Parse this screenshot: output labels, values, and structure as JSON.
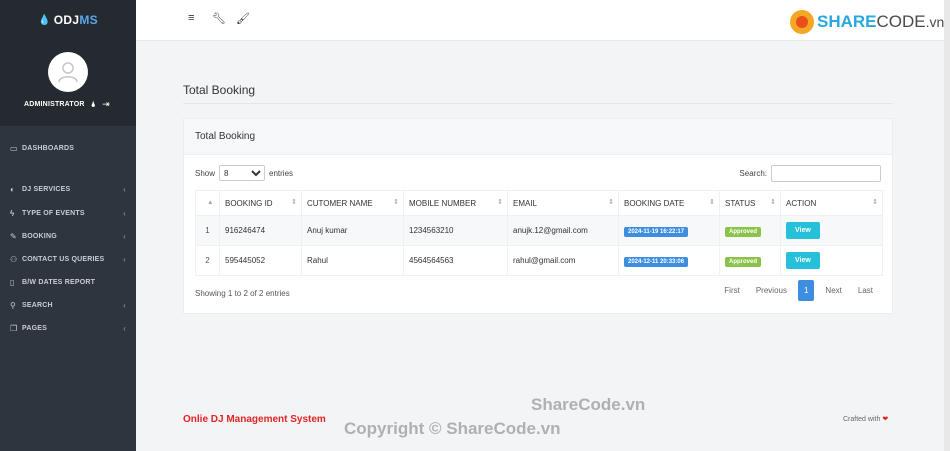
{
  "brand": {
    "name_a": "ODJ",
    "name_b": "MS"
  },
  "user": {
    "role": "ADMINISTRATOR"
  },
  "nav": [
    {
      "label": "DASHBOARDS",
      "icon": "dashboard-icon",
      "has_sub": false
    },
    {
      "label": "DJ SERVICES",
      "icon": "headphones-icon",
      "has_sub": true
    },
    {
      "label": "TYPE OF EVENTS",
      "icon": "bolt-icon",
      "has_sub": true
    },
    {
      "label": "BOOKING",
      "icon": "edit-icon",
      "has_sub": true
    },
    {
      "label": "CONTACT US QUERIES",
      "icon": "users-icon",
      "has_sub": true
    },
    {
      "label": "B/W DATES REPORT",
      "icon": "file-icon",
      "has_sub": false
    },
    {
      "label": "SEARCH",
      "icon": "search-icon",
      "has_sub": true
    },
    {
      "label": "PAGES",
      "icon": "copy-icon",
      "has_sub": true
    }
  ],
  "page": {
    "title": "Total Booking"
  },
  "card": {
    "title": "Total Booking",
    "show_label": "Show",
    "entries_label": "entries",
    "page_length": "8",
    "search_label": "Search:",
    "search_value": ""
  },
  "table": {
    "columns": [
      "",
      "BOOKING ID",
      "CUTOMER NAME",
      "MOBILE NUMBER",
      "EMAIL",
      "BOOKING DATE",
      "STATUS",
      "ACTION"
    ],
    "rows": [
      {
        "num": "1",
        "booking_id": "916246474",
        "name": "Anuj kumar",
        "mobile": "1234563210",
        "email": "anujk.12@gmail.com",
        "date": "2024-11-19 16:22:17",
        "status": "Approved",
        "action": "View"
      },
      {
        "num": "2",
        "booking_id": "595445052",
        "name": "Rahul",
        "mobile": "4564564563",
        "email": "rahul@gmail.com",
        "date": "2024-12-11 20:33:06",
        "status": "Approved",
        "action": "View"
      }
    ]
  },
  "info": "Showing 1 to 2 of 2 entries",
  "pager": {
    "first": "First",
    "previous": "Previous",
    "current": "1",
    "next": "Next",
    "last": "Last"
  },
  "footer": {
    "left": "Onlie DJ Management System",
    "right": "Crafted with"
  },
  "watermark": {
    "logo_a": "SHARE",
    "logo_b": "CODE",
    "logo_c": ".vn",
    "line1": "ShareCode.vn",
    "line2": "Copyright © ShareCode.vn"
  },
  "colors": {
    "sidebar": "#2f353e",
    "accent": "#3d8ee0",
    "approved": "#8bc34a",
    "view": "#26c0da",
    "footer_red": "#e02424"
  }
}
